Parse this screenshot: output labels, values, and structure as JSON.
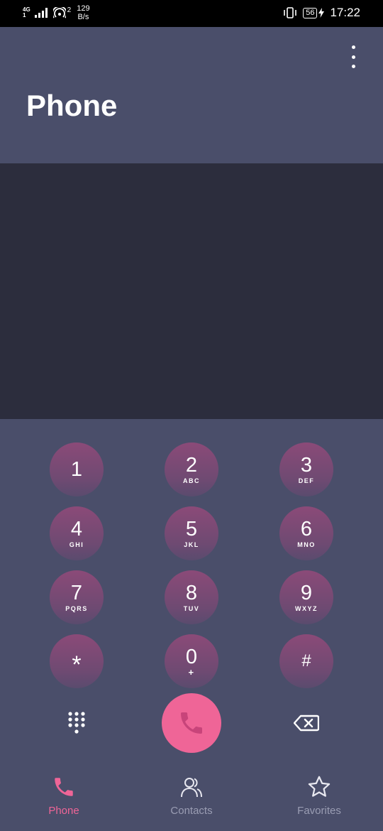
{
  "status_bar": {
    "network_type": "4G",
    "signal_sub": "1",
    "hotspot_count": "2",
    "speed_value": "129",
    "speed_unit": "B/s",
    "battery": "56",
    "time": "17:22"
  },
  "header": {
    "title": "Phone",
    "overflow_icon": "more-vertical-icon"
  },
  "dialpad": {
    "keys": [
      {
        "digit": "1",
        "letters": ""
      },
      {
        "digit": "2",
        "letters": "ABC"
      },
      {
        "digit": "3",
        "letters": "DEF"
      },
      {
        "digit": "4",
        "letters": "GHI"
      },
      {
        "digit": "5",
        "letters": "JKL"
      },
      {
        "digit": "6",
        "letters": "MNO"
      },
      {
        "digit": "7",
        "letters": "PQRS"
      },
      {
        "digit": "8",
        "letters": "TUV"
      },
      {
        "digit": "9",
        "letters": "WXYZ"
      },
      {
        "digit": "*",
        "letters": ""
      },
      {
        "digit": "0",
        "letters": "+"
      },
      {
        "digit": "#",
        "letters": ""
      }
    ]
  },
  "actions": {
    "dialpad_icon": "dialpad-icon",
    "call_icon": "phone-icon",
    "backspace_icon": "backspace-icon"
  },
  "bottom_nav": {
    "items": [
      {
        "label": "Phone",
        "icon": "phone-icon",
        "active": true
      },
      {
        "label": "Contacts",
        "icon": "contacts-icon",
        "active": false
      },
      {
        "label": "Favorites",
        "icon": "star-icon",
        "active": false
      }
    ]
  },
  "colors": {
    "background": "#4a4e6a",
    "display_area": "#2c2d3d",
    "accent": "#ef6597",
    "key_top": "#8b4a78",
    "inactive_nav": "#9a9db3"
  }
}
